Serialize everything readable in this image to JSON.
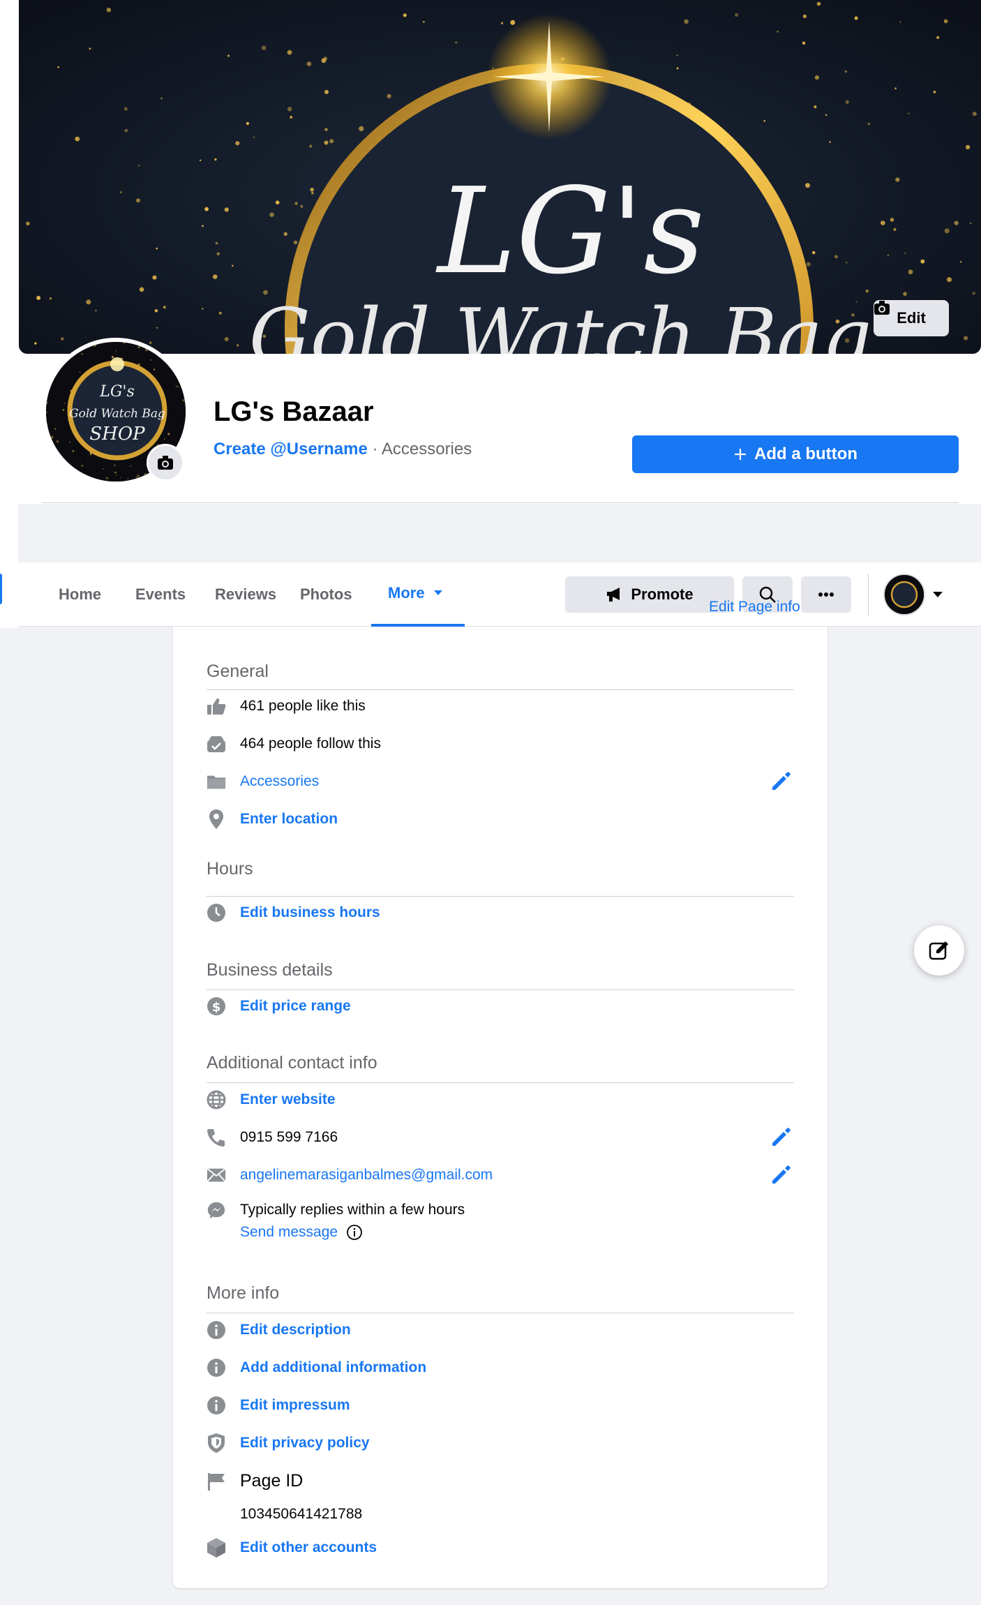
{
  "cover": {
    "edit_label": "Edit",
    "script_text": "LG's",
    "script_subtext": "Gold Watch Bag"
  },
  "avatar": {
    "lines": [
      "LG's",
      "Gold Watch Bag",
      "SHOP"
    ]
  },
  "page": {
    "name": "LG's Bazaar",
    "username_link": "Create @Username",
    "separator": " · ",
    "category": "Accessories"
  },
  "add_button_label": "Add a button",
  "nav": {
    "tabs": [
      "Home",
      "Events",
      "Reviews",
      "Photos",
      "More"
    ],
    "active_tab": "More",
    "promote_label": "Promote",
    "tooltip_link": "Edit Page info"
  },
  "about": {
    "general": {
      "title": "General",
      "likes": "461 people like this",
      "follows": "464 people follow this",
      "category": "Accessories",
      "location": "Enter location"
    },
    "hours": {
      "title": "Hours",
      "edit": "Edit business hours"
    },
    "business": {
      "title": "Business details",
      "price": "Edit price range"
    },
    "contact": {
      "title": "Additional contact info",
      "website": "Enter website",
      "phone": "0915 599 7166",
      "email": "angelinemarasiganbalmes@gmail.com",
      "reply_time": "Typically replies within a few hours",
      "send_message": "Send message"
    },
    "more": {
      "title": "More info",
      "description": "Edit description",
      "additional": "Add additional information",
      "impressum": "Edit impressum",
      "privacy": "Edit privacy policy",
      "page_id_label": "Page ID",
      "page_id": "103450641421788",
      "other_accounts": "Edit other accounts"
    }
  },
  "colors": {
    "accent": "#1877f2",
    "icon_gray": "#8a8d91",
    "gold": "#e0a82e"
  }
}
